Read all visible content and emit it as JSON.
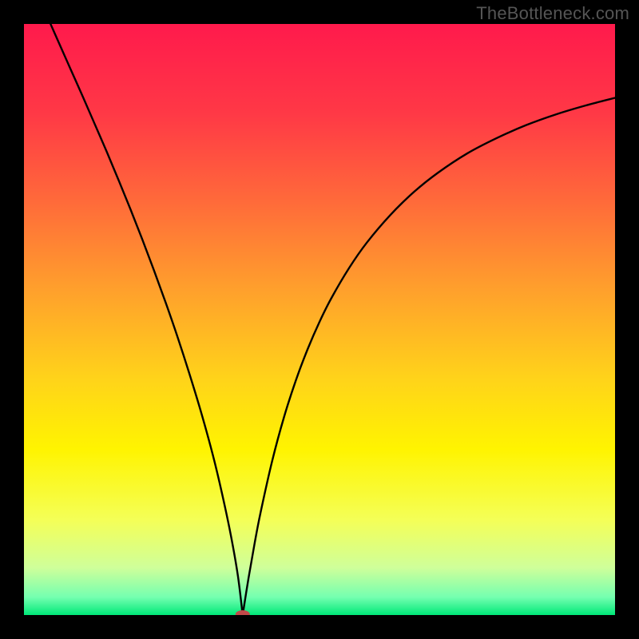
{
  "watermark": "TheBottleneck.com",
  "chart_data": {
    "type": "line",
    "title": "",
    "xlabel": "",
    "ylabel": "",
    "xlim": [
      0,
      100
    ],
    "ylim": [
      0,
      100
    ],
    "background_gradient": {
      "stops": [
        {
          "offset": 0.0,
          "color": "#ff1a4c"
        },
        {
          "offset": 0.15,
          "color": "#ff3846"
        },
        {
          "offset": 0.3,
          "color": "#ff6a3a"
        },
        {
          "offset": 0.45,
          "color": "#ffa02c"
        },
        {
          "offset": 0.6,
          "color": "#ffd31a"
        },
        {
          "offset": 0.72,
          "color": "#fff400"
        },
        {
          "offset": 0.84,
          "color": "#f4ff58"
        },
        {
          "offset": 0.92,
          "color": "#cfff9a"
        },
        {
          "offset": 0.97,
          "color": "#74ffb0"
        },
        {
          "offset": 1.0,
          "color": "#00e878"
        }
      ]
    },
    "series": [
      {
        "name": "bottleneck-curve",
        "color": "#000000",
        "stroke_width": 2.4,
        "x": [
          4.5,
          6,
          8,
          10,
          12,
          14,
          16,
          18,
          20,
          22,
          24,
          26,
          28,
          30,
          32,
          33.5,
          35,
          36.2,
          37,
          38,
          39,
          40,
          42,
          44,
          46,
          48,
          50,
          52,
          55,
          58,
          62,
          66,
          70,
          75,
          80,
          85,
          90,
          95,
          100
        ],
        "y": [
          100,
          96.6,
          92.1,
          87.6,
          83.0,
          78.4,
          73.6,
          68.7,
          63.6,
          58.3,
          52.8,
          47.0,
          40.8,
          34.2,
          26.9,
          20.6,
          13.5,
          6.6,
          0.0,
          6.3,
          12.0,
          17.2,
          26.1,
          33.5,
          39.7,
          45.0,
          49.6,
          53.6,
          58.7,
          63.0,
          67.7,
          71.6,
          74.8,
          78.1,
          80.7,
          82.9,
          84.7,
          86.2,
          87.5
        ]
      }
    ],
    "marker": {
      "name": "optimum-marker",
      "x": 37,
      "y": 0,
      "color": "#c24a4a",
      "rx": 9,
      "ry": 5
    }
  }
}
